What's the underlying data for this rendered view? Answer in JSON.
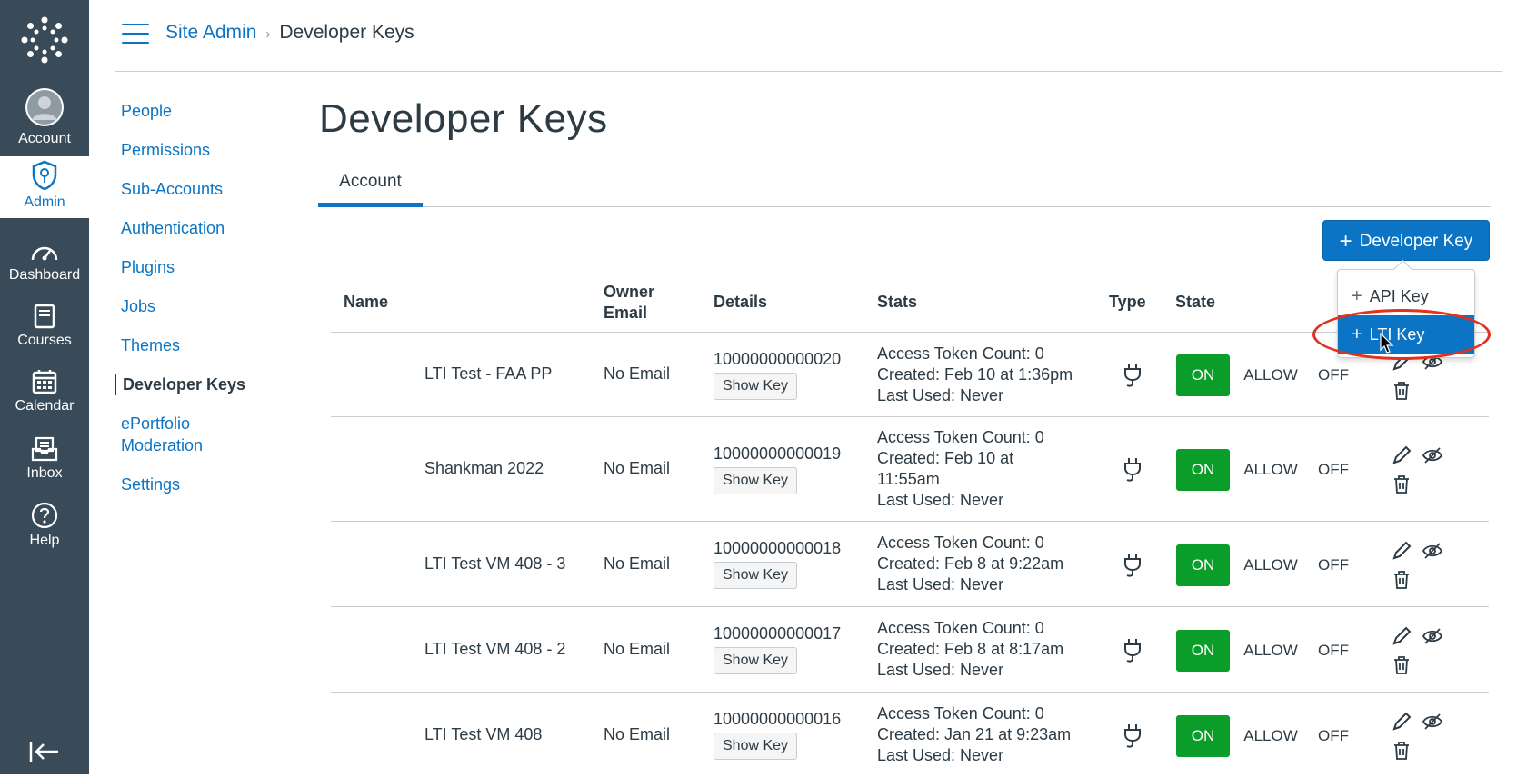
{
  "global_nav": {
    "items": [
      {
        "label": "Account",
        "icon": "account-avatar-icon"
      },
      {
        "label": "Admin",
        "icon": "admin-shield-icon",
        "active": true
      },
      {
        "label": "Dashboard",
        "icon": "dashboard-icon"
      },
      {
        "label": "Courses",
        "icon": "courses-book-icon"
      },
      {
        "label": "Calendar",
        "icon": "calendar-icon"
      },
      {
        "label": "Inbox",
        "icon": "inbox-icon"
      },
      {
        "label": "Help",
        "icon": "help-icon"
      }
    ]
  },
  "header": {
    "breadcrumb": {
      "root": "Site Admin",
      "separator": "›",
      "current": "Developer Keys"
    }
  },
  "admin_nav": {
    "items": [
      {
        "label": "People"
      },
      {
        "label": "Permissions"
      },
      {
        "label": "Sub-Accounts"
      },
      {
        "label": "Authentication"
      },
      {
        "label": "Plugins"
      },
      {
        "label": "Jobs"
      },
      {
        "label": "Themes"
      },
      {
        "label": "Developer Keys",
        "active": true
      },
      {
        "label": "ePortfolio Moderation"
      },
      {
        "label": "Settings"
      }
    ]
  },
  "main": {
    "title": "Developer Keys",
    "tabs": [
      {
        "label": "Account",
        "active": true
      }
    ],
    "add_button": {
      "label": "Developer Key",
      "icon": "plus-icon"
    },
    "add_menu": {
      "items": [
        {
          "label": "API Key",
          "icon": "plus-icon"
        },
        {
          "label": "LTI Key",
          "icon": "plus-icon",
          "highlighted": true
        }
      ]
    },
    "table": {
      "headers": {
        "name": "Name",
        "owner_email_1": "Owner",
        "owner_email_2": "Email",
        "details": "Details",
        "stats": "Stats",
        "type": "Type",
        "state": "State"
      },
      "rows": [
        {
          "name": "LTI Test - FAA PP",
          "email": "No Email",
          "id": "10000000000020",
          "show_key": "Show Key",
          "stats": [
            "Access Token Count: 0",
            "Created: Feb 10 at 1:36pm",
            "Last Used: Never"
          ],
          "state": {
            "on": "ON",
            "allow": "ALLOW",
            "off": "OFF"
          }
        },
        {
          "name": "Shankman 2022",
          "email": "No Email",
          "id": "10000000000019",
          "show_key": "Show Key",
          "stats": [
            "Access Token Count: 0",
            "Created: Feb 10 at",
            "11:55am",
            "Last Used: Never"
          ],
          "state": {
            "on": "ON",
            "allow": "ALLOW",
            "off": "OFF"
          }
        },
        {
          "name": "LTI Test VM 408 - 3",
          "email": "No Email",
          "id": "10000000000018",
          "show_key": "Show Key",
          "stats": [
            "Access Token Count: 0",
            "Created: Feb 8 at 9:22am",
            "Last Used: Never"
          ],
          "state": {
            "on": "ON",
            "allow": "ALLOW",
            "off": "OFF"
          }
        },
        {
          "name": "LTI Test VM 408 - 2",
          "email": "No Email",
          "id": "10000000000017",
          "show_key": "Show Key",
          "stats": [
            "Access Token Count: 0",
            "Created: Feb 8 at 8:17am",
            "Last Used: Never"
          ],
          "state": {
            "on": "ON",
            "allow": "ALLOW",
            "off": "OFF"
          }
        },
        {
          "name": "LTI Test VM 408",
          "email": "No Email",
          "id": "10000000000016",
          "show_key": "Show Key",
          "stats": [
            "Access Token Count: 0",
            "Created: Jan 21 at 9:23am",
            "Last Used: Never"
          ],
          "state": {
            "on": "ON",
            "allow": "ALLOW",
            "off": "OFF"
          }
        }
      ]
    }
  },
  "colors": {
    "nav_bg": "#394b58",
    "brand_blue": "#0b74c4",
    "on_green": "#0b9d29",
    "highlight_red": "#e0321e"
  }
}
